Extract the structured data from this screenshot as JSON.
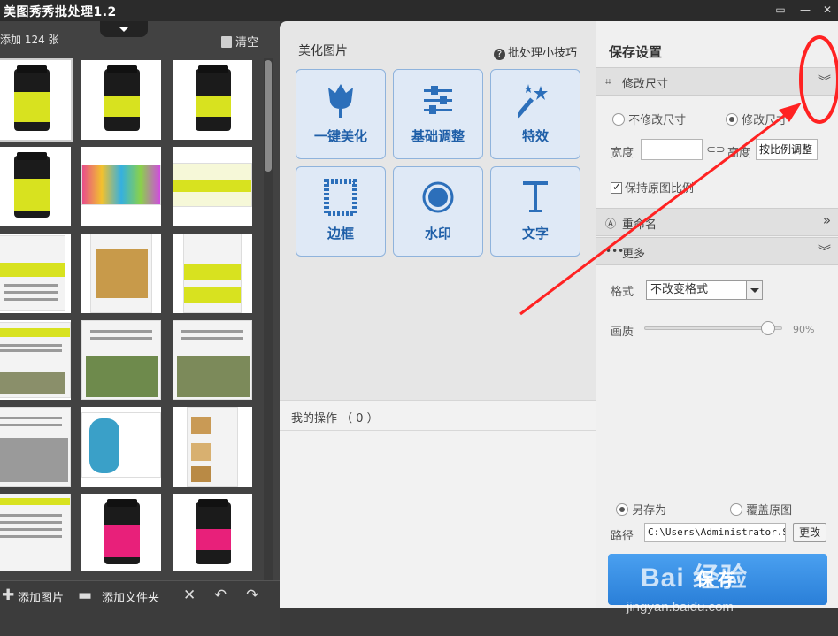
{
  "app": {
    "title": "美图秀秀批处理1.2"
  },
  "left": {
    "count_label": "添加 124 张",
    "clear_label": "清空",
    "add_image_label": "添加图片",
    "add_folder_label": "添加文件夹"
  },
  "center": {
    "heading": "美化图片",
    "tips_label": "批处理小技巧",
    "tools": [
      {
        "label": "一键美化",
        "icon": "tulip-icon"
      },
      {
        "label": "基础调整",
        "icon": "sliders-icon"
      },
      {
        "label": "特效",
        "icon": "magic-wand-icon"
      },
      {
        "label": "边框",
        "icon": "frame-icon"
      },
      {
        "label": "水印",
        "icon": "watermark-icon"
      },
      {
        "label": "文字",
        "icon": "text-icon"
      }
    ],
    "ops_label": "我的操作 （ 0 ）"
  },
  "right": {
    "title": "保存设置",
    "resize": {
      "label": "修改尺寸",
      "option_keep": "不修改尺寸",
      "option_modify": "修改尺寸",
      "width_label": "宽度",
      "width_value": "",
      "height_label": "高度",
      "height_value": "按比例调整",
      "keep_ratio_label": "保持原图比例",
      "keep_ratio_checked": true
    },
    "rename": {
      "label": "重命名"
    },
    "more": {
      "label": "更多",
      "format_label": "格式",
      "format_value": "不改变格式",
      "quality_label": "画质",
      "quality_value": "90%",
      "quality_level": 0.9
    },
    "save": {
      "option_saveas": "另存为",
      "option_overwrite": "覆盖原图",
      "path_label": "路径",
      "path_value": "C:\\Users\\Administrator.SK",
      "change_label": "更改",
      "save_button": "保存"
    }
  },
  "watermark": {
    "brand": "Bai 经验",
    "url": "jingyan.baidu.com"
  },
  "colors": {
    "accent": "#2a7fd8",
    "annotation": "#ff2222",
    "tile_blue": "#1f5fa8"
  }
}
